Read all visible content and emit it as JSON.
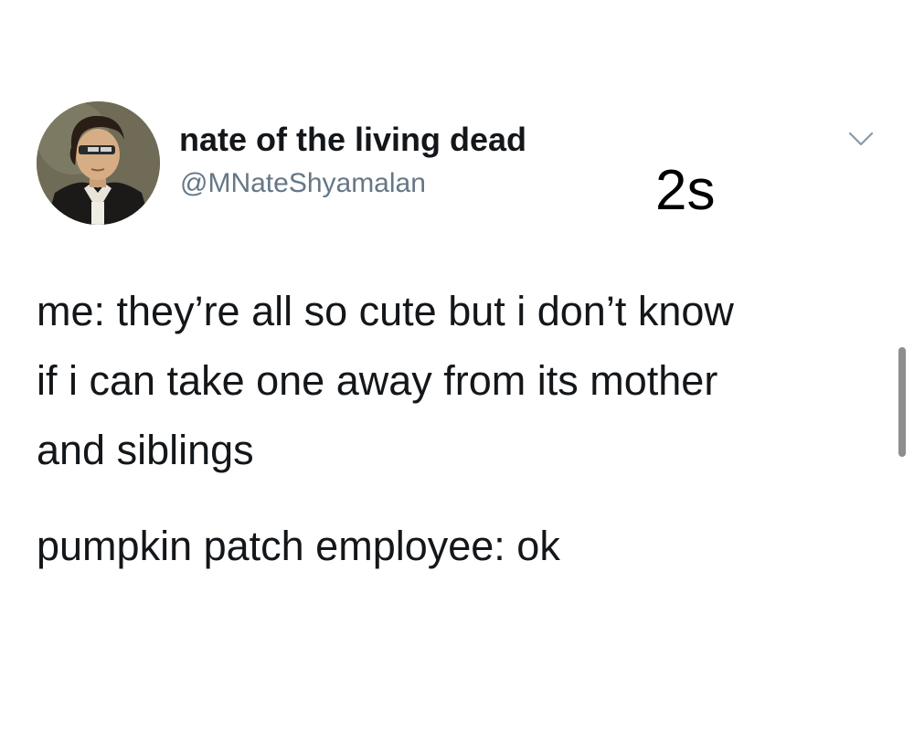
{
  "tweet": {
    "display_name": "nate of the living dead",
    "handle": "@MNateShyamalan",
    "timestamp": "2s",
    "body_lines": [
      "me: they’re all so cute but i don’t know",
      "if i can take one away from its mother",
      "and siblings"
    ],
    "body_line_2": "pumpkin patch employee: ok",
    "menu_icon": "chevron-down-icon"
  },
  "colors": {
    "text": "#14171a",
    "handle": "#657786",
    "background": "#ffffff",
    "scrollbar": "#8e8e8e"
  }
}
